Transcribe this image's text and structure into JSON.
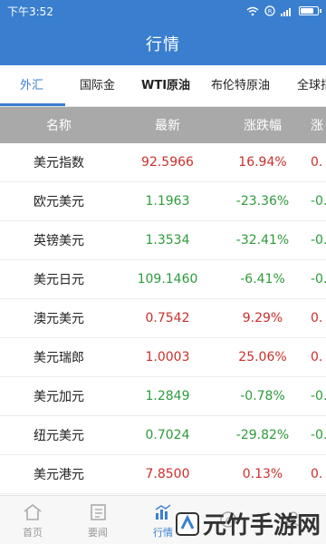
{
  "status_bar": {
    "time": "下午3:52",
    "icons": [
      "wifi-icon",
      "sim-icon",
      "signal-icon",
      "battery-icon"
    ],
    "battery_level": 0.8
  },
  "header": {
    "title": "行情"
  },
  "tabs": [
    {
      "label": "外汇",
      "active": true
    },
    {
      "label": "国际金",
      "active": false
    },
    {
      "label": "WTI原油",
      "active": false
    },
    {
      "label": "布伦特原油",
      "active": false
    },
    {
      "label": "全球指",
      "active": false
    }
  ],
  "table": {
    "columns": [
      "名称",
      "最新",
      "涨跌幅",
      "涨"
    ],
    "rows": [
      {
        "name": "美元指数",
        "latest": "92.5966",
        "change": "16.94%",
        "extra": "0.",
        "dir": "up"
      },
      {
        "name": "欧元美元",
        "latest": "1.1963",
        "change": "-23.36%",
        "extra": "-0.",
        "dir": "down"
      },
      {
        "name": "英镑美元",
        "latest": "1.3534",
        "change": "-32.41%",
        "extra": "-0.",
        "dir": "down"
      },
      {
        "name": "美元日元",
        "latest": "109.1460",
        "change": "-6.41%",
        "extra": "-0.",
        "dir": "down"
      },
      {
        "name": "澳元美元",
        "latest": "0.7542",
        "change": "9.29%",
        "extra": "0.",
        "dir": "up"
      },
      {
        "name": "美元瑞郎",
        "latest": "1.0003",
        "change": "25.06%",
        "extra": "0.",
        "dir": "up"
      },
      {
        "name": "美元加元",
        "latest": "1.2849",
        "change": "-0.78%",
        "extra": "-0.",
        "dir": "down"
      },
      {
        "name": "纽元美元",
        "latest": "0.7024",
        "change": "-29.82%",
        "extra": "-0.",
        "dir": "down"
      },
      {
        "name": "美元港元",
        "latest": "7.8500",
        "change": "0.13%",
        "extra": "0.",
        "dir": "up"
      }
    ]
  },
  "bottom_nav": [
    {
      "label": "首页",
      "icon": "home-icon",
      "active": false
    },
    {
      "label": "要闻",
      "icon": "news-icon",
      "active": false
    },
    {
      "label": "行情",
      "icon": "chart-icon",
      "active": true
    },
    {
      "label": "",
      "icon": "compass-icon",
      "active": false
    },
    {
      "label": "",
      "icon": "user-icon",
      "active": false
    }
  ],
  "watermark": {
    "text": "元竹手游网"
  },
  "colors": {
    "primary": "#3a7fcf",
    "up": "#c9302c",
    "down": "#2e9b3c",
    "header_gray": "#a9a9a9"
  }
}
